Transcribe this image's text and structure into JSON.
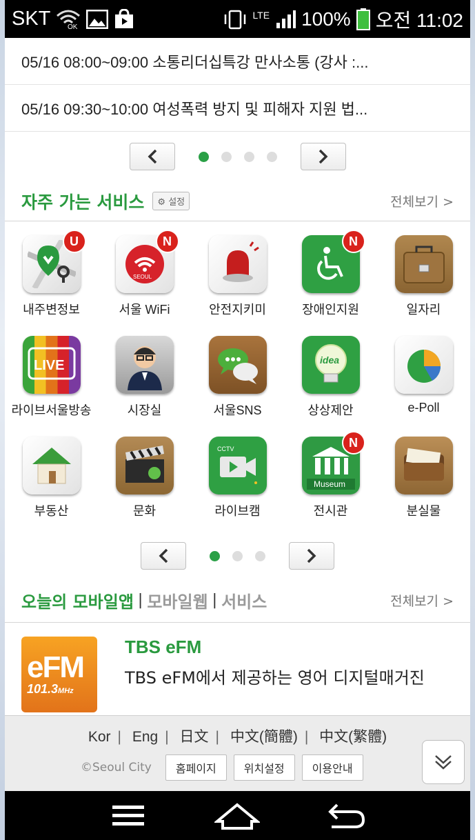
{
  "statusbar": {
    "carrier": "SKT",
    "wifi_label": "OK",
    "network": "LTE",
    "battery": "100%",
    "time": "오전 11:02"
  },
  "notices": [
    "05/16 08:00~09:00 소통리더십특강 만사소통 (강사 :...",
    "05/16 09:30~10:00 여성폭력 방지 및 피해자 지원 법..."
  ],
  "notice_pager": {
    "pages": 4,
    "current": 1
  },
  "frequent": {
    "title": "자주 가는 서비스",
    "setting": "설정",
    "view_all": "전체보기 >",
    "apps": [
      {
        "label": "내주변정보",
        "badge": "U",
        "icon": "map-pin-icon"
      },
      {
        "label": "서울 WiFi",
        "badge": "N",
        "icon": "wifi-icon",
        "sub": "SEOUL"
      },
      {
        "label": "안전지키미",
        "badge": "",
        "icon": "siren-icon"
      },
      {
        "label": "장애인지원",
        "badge": "N",
        "icon": "wheelchair-icon"
      },
      {
        "label": "일자리",
        "badge": "",
        "icon": "briefcase-icon"
      },
      {
        "label": "라이브서울방송",
        "badge": "",
        "icon": "live-tv-icon",
        "sub": "LIVE"
      },
      {
        "label": "시장실",
        "badge": "",
        "icon": "mayor-avatar-icon"
      },
      {
        "label": "서울SNS",
        "badge": "",
        "icon": "chat-bubbles-icon"
      },
      {
        "label": "상상제안",
        "badge": "",
        "icon": "idea-bulb-icon",
        "sub": "idea"
      },
      {
        "label": "e-Poll",
        "badge": "",
        "icon": "pie-chart-icon"
      },
      {
        "label": "부동산",
        "badge": "",
        "icon": "house-icon"
      },
      {
        "label": "문화",
        "badge": "",
        "icon": "clapperboard-icon"
      },
      {
        "label": "라이브캠",
        "badge": "",
        "icon": "cctv-camera-icon",
        "sub": "CCTV"
      },
      {
        "label": "전시관",
        "badge": "N",
        "icon": "museum-icon",
        "sub": "Museum"
      },
      {
        "label": "분실물",
        "badge": "",
        "icon": "wallet-icon"
      }
    ],
    "pager": {
      "pages": 3,
      "current": 1
    }
  },
  "today": {
    "tab_app": "오늘의 모바일앱",
    "tab_web": "모바일웹",
    "tab_service": "서비스",
    "view_all": "전체보기 >",
    "featured": {
      "logo_text": "eFM",
      "logo_freq": "101.3",
      "logo_unit": "MHz",
      "title": "TBS eFM",
      "desc": "TBS eFM에서 제공하는 영어 디지털매거진"
    }
  },
  "footer": {
    "langs": [
      "Kor",
      "Eng",
      "日文",
      "中文(簡體)",
      "中文(繁體)"
    ],
    "copyright": "©Seoul City",
    "buttons": [
      "홈페이지",
      "위치설정",
      "이용안내"
    ]
  }
}
